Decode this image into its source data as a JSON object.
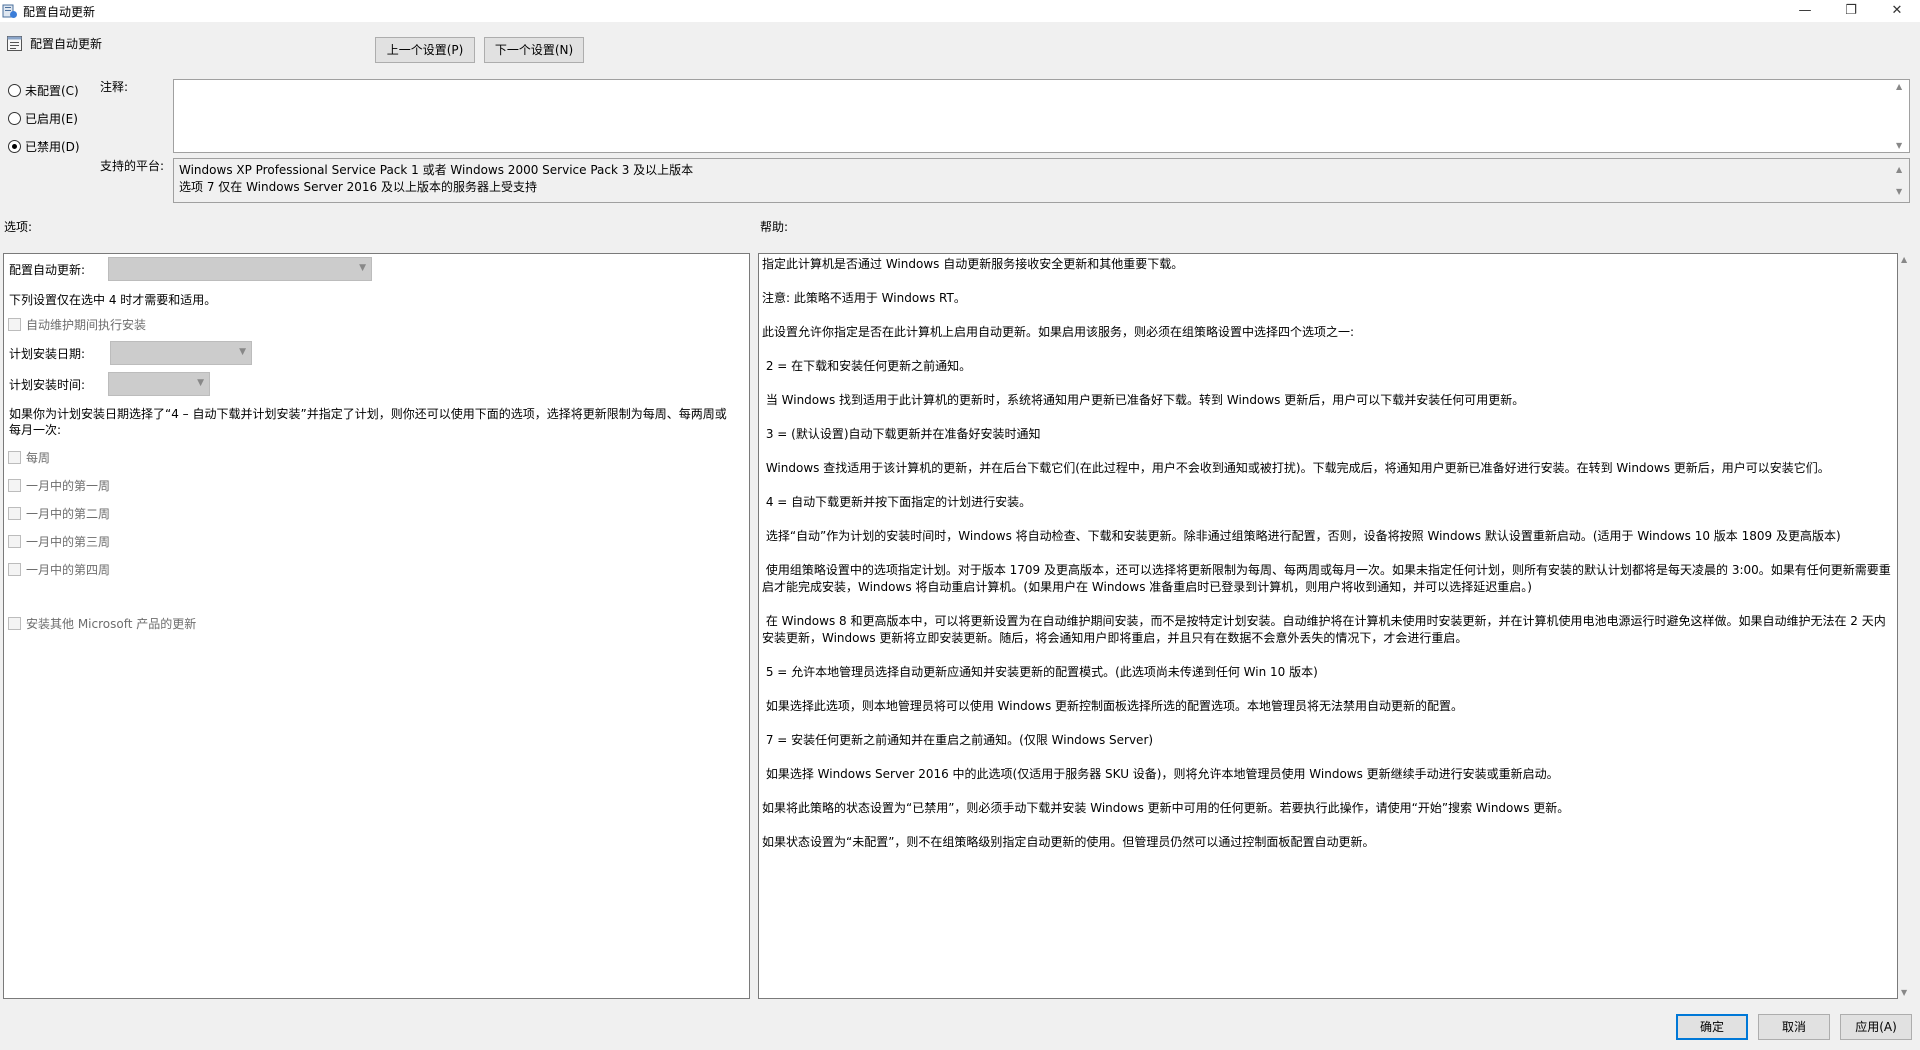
{
  "window": {
    "title": "配置自动更新",
    "minimize_glyph": "—",
    "maximize_glyph": "❐",
    "close_glyph": "✕",
    "app_icon": "group-policy-icon"
  },
  "header": {
    "policy_name": "配置自动更新",
    "policy_icon": "policy-setting-icon",
    "prev_label": "上一个设置(P)",
    "next_label": "下一个设置(N)"
  },
  "state": {
    "options": [
      {
        "label": "未配置(C)",
        "checked": false
      },
      {
        "label": "已启用(E)",
        "checked": false
      },
      {
        "label": "已禁用(D)",
        "checked": true
      }
    ]
  },
  "comment": {
    "label": "注释:",
    "value": ""
  },
  "platform": {
    "label": "支持的平台:",
    "lines": [
      "Windows XP Professional Service Pack 1 或者 Windows 2000 Service Pack 3 及以上版本",
      "选项 7 仅在 Windows Server 2016 及以上版本的服务器上受支持"
    ]
  },
  "options_section": {
    "label": "选项:",
    "configure_label": "配置自动更新:",
    "configure_value": "",
    "note": "下列设置仅在选中 4 时才需要和适用。",
    "maintenance_install": "自动维护期间执行安装",
    "schedule_day_label": "计划安装日期:",
    "schedule_day_value": "",
    "schedule_time_label": "计划安装时间:",
    "schedule_time_value": "",
    "limit_note": "如果你为计划安装日期选择了“4 – 自动下载并计划安装”并指定了计划，则你还可以使用下面的选项，选择将更新限制为每周、每两周或每月一次:",
    "weekly": "每周",
    "week1": "一月中的第一周",
    "week2": "一月中的第二周",
    "week3": "一月中的第三周",
    "week4": "一月中的第四周",
    "other_products": "安装其他 Microsoft 产品的更新"
  },
  "help_section": {
    "label": "帮助:",
    "paragraphs": [
      "指定此计算机是否通过 Windows 自动更新服务接收安全更新和其他重要下载。",
      "注意: 此策略不适用于 Windows RT。",
      "此设置允许你指定是否在此计算机上启用自动更新。如果启用该服务，则必须在组策略设置中选择四个选项之一:",
      " 2 = 在下载和安装任何更新之前通知。",
      " 当 Windows 找到适用于此计算机的更新时，系统将通知用户更新已准备好下载。转到 Windows 更新后，用户可以下载并安装任何可用更新。",
      " 3 = (默认设置)自动下载更新并在准备好安装时通知",
      " Windows 查找适用于该计算机的更新，并在后台下载它们(在此过程中，用户不会收到通知或被打扰)。下载完成后，将通知用户更新已准备好进行安装。在转到 Windows 更新后，用户可以安装它们。",
      " 4 = 自动下载更新并按下面指定的计划进行安装。",
      " 选择“自动”作为计划的安装时间时，Windows 将自动检查、下载和安装更新。除非通过组策略进行配置，否则，设备将按照 Windows 默认设置重新启动。(适用于 Windows 10 版本 1809 及更高版本)",
      " 使用组策略设置中的选项指定计划。对于版本 1709 及更高版本，还可以选择将更新限制为每周、每两周或每月一次。如果未指定任何计划，则所有安装的默认计划都将是每天凌晨的 3:00。如果有任何更新需要重启才能完成安装，Windows 将自动重启计算机。(如果用户在 Windows 准备重启时已登录到计算机，则用户将收到通知，并可以选择延迟重启。)",
      " 在 Windows 8 和更高版本中，可以将更新设置为在自动维护期间安装，而不是按特定计划安装。自动维护将在计算机未使用时安装更新，并在计算机使用电池电源运行时避免这样做。如果自动维护无法在 2 天内安装更新，Windows 更新将立即安装更新。随后，将会通知用户即将重启，并且只有在数据不会意外丢失的情况下，才会进行重启。",
      " 5 = 允许本地管理员选择自动更新应通知并安装更新的配置模式。(此选项尚未传递到任何 Win 10 版本)",
      " 如果选择此选项，则本地管理员将可以使用 Windows 更新控制面板选择所选的配置选项。本地管理员将无法禁用自动更新的配置。",
      " 7 = 安装任何更新之前通知并在重启之前通知。(仅限 Windows Server)",
      " 如果选择 Windows Server 2016 中的此选项(仅适用于服务器 SKU 设备)，则将允许本地管理员使用 Windows 更新继续手动进行安装或重新启动。",
      "如果将此策略的状态设置为“已禁用”，则必须手动下载并安装 Windows 更新中可用的任何更新。若要执行此操作，请使用“开始”搜索 Windows 更新。",
      "如果状态设置为“未配置”，则不在组策略级别指定自动更新的使用。但管理员仍然可以通过控制面板配置自动更新。"
    ]
  },
  "footer": {
    "ok_label": "确定",
    "cancel_label": "取消",
    "apply_label": "应用(A)"
  },
  "colors": {
    "accent": "#0078d7",
    "background": "#f0f0f0"
  }
}
